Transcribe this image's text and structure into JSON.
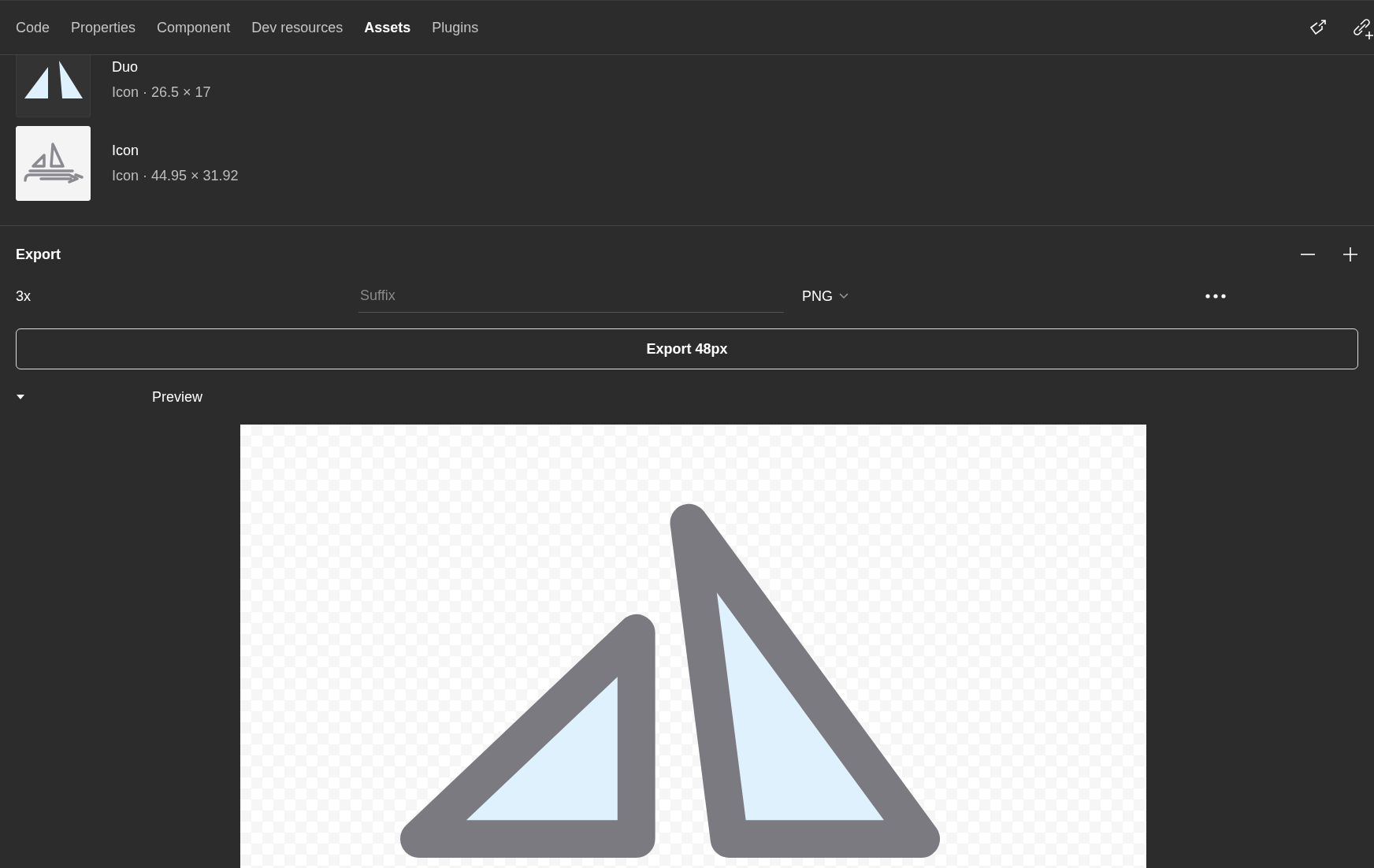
{
  "tabs": [
    {
      "label": "Code",
      "selected": false
    },
    {
      "label": "Properties",
      "selected": false
    },
    {
      "label": "Component",
      "selected": false
    },
    {
      "label": "Dev resources",
      "selected": false
    },
    {
      "label": "Assets",
      "selected": true
    },
    {
      "label": "Plugins",
      "selected": false
    }
  ],
  "assets": [
    {
      "name": "Duo",
      "meta": "Icon · 26.5 × 17",
      "kind": "duo"
    },
    {
      "name": "Icon",
      "meta": "Icon · 44.95 × 31.92",
      "kind": "outline"
    }
  ],
  "export": {
    "title": "Export",
    "scale": "3x",
    "suffix": {
      "placeholder": "Suffix"
    },
    "format": "PNG",
    "button": "Export 48px",
    "preview": {
      "label": "Preview",
      "expanded": true
    }
  }
}
